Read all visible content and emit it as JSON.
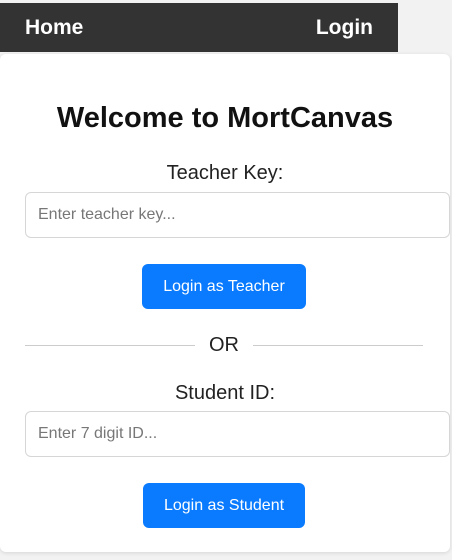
{
  "nav": {
    "home_label": "Home",
    "login_label": "Login"
  },
  "card": {
    "title": "Welcome to MortCanvas",
    "teacher": {
      "label": "Teacher Key:",
      "placeholder": "Enter teacher key...",
      "value": "",
      "button_label": "Login as Teacher"
    },
    "divider_text": "OR",
    "student": {
      "label": "Student ID:",
      "placeholder": "Enter 7 digit ID...",
      "value": "",
      "button_label": "Login as Student"
    }
  },
  "colors": {
    "navbar_bg": "#333333",
    "primary_button": "#0a7bff",
    "page_bg": "#f2f2f2",
    "card_bg": "#ffffff"
  }
}
